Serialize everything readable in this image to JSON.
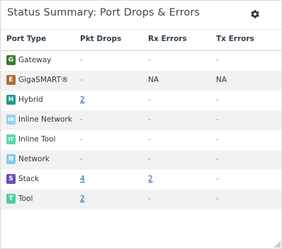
{
  "panel": {
    "title": "Status Summary: Port Drops & Errors",
    "settings_icon": "gear-icon"
  },
  "columns": {
    "port_type": "Port Type",
    "pkt_drops": "Pkt Drops",
    "rx_errors": "Rx Errors",
    "tx_errors": "Tx Errors"
  },
  "rows": [
    {
      "badge": "G",
      "badge_color": "#3d7a2e",
      "port_type": "Gateway",
      "pkt_drops": "-",
      "rx_errors": "-",
      "tx_errors": "-"
    },
    {
      "badge": "E",
      "badge_color": "#b06a3a",
      "port_type": "GigaSMART®",
      "pkt_drops": "-",
      "rx_errors": "NA",
      "tx_errors": "NA"
    },
    {
      "badge": "H",
      "badge_color": "#1f9a8a",
      "port_type": "Hybrid",
      "pkt_drops": "2",
      "rx_errors": "-",
      "tx_errors": "-"
    },
    {
      "badge": "IN",
      "badge_color": "#8fd3ee",
      "port_type": "Inline Network",
      "pkt_drops": "-",
      "rx_errors": "-",
      "tx_errors": "-"
    },
    {
      "badge": "IT",
      "badge_color": "#5ed6a8",
      "port_type": "Inline Tool",
      "pkt_drops": "-",
      "rx_errors": "-",
      "tx_errors": "-"
    },
    {
      "badge": "N",
      "badge_color": "#7fcbe6",
      "port_type": "Network",
      "pkt_drops": "-",
      "rx_errors": "-",
      "tx_errors": "-"
    },
    {
      "badge": "S",
      "badge_color": "#6a4fb3",
      "port_type": "Stack",
      "pkt_drops": "4",
      "rx_errors": "2",
      "tx_errors": "-"
    },
    {
      "badge": "T",
      "badge_color": "#4ccfa0",
      "port_type": "Tool",
      "pkt_drops": "2",
      "rx_errors": "-",
      "tx_errors": "-"
    }
  ]
}
